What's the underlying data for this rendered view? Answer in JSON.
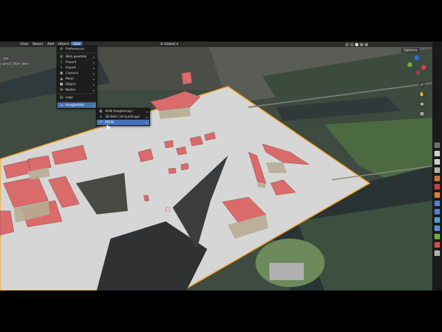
{
  "menubar": {
    "items": [
      "View",
      "Select",
      "Add",
      "Object",
      "Geo"
    ],
    "active_index": 4
  },
  "header": {
    "transform_orientation": "Global",
    "options_label": "Options"
  },
  "scene_overlay": {
    "view_name": "...ive",
    "object_name": "| ahn3_05m_dtm"
  },
  "geo_menu": {
    "items": [
      {
        "icon": "gear-icon",
        "label": "Preferences"
      },
      {
        "icon": "globe-icon",
        "label": "Web geodata",
        "submenu": true
      },
      {
        "icon": "import-icon",
        "label": "Import",
        "submenu": true
      },
      {
        "icon": "export-icon",
        "label": "Export",
        "submenu": true
      },
      {
        "icon": "camera-icon",
        "label": "Camera",
        "submenu": true
      },
      {
        "icon": "mesh-icon",
        "label": "Mesh",
        "submenu": true
      },
      {
        "icon": "cube-icon",
        "label": "Object",
        "submenu": true
      },
      {
        "icon": "nodes-icon",
        "label": "Nodes",
        "submenu": true
      },
      {
        "icon": "logs-icon",
        "label": "Logs"
      },
      {
        "icon": "hoogtedata-icon",
        "label": "Hoogtedata",
        "submenu": true,
        "highlighted": true
      }
    ]
  },
  "hoogtedata_submenu": {
    "items": [
      {
        "icon": "heightmap-icon",
        "label": "AHN (heightmap)",
        "submenu": true
      },
      {
        "icon": "buildings-icon",
        "label": "3D BAG (3d buildings)",
        "submenu": true
      },
      {
        "icon": "pdok-icon",
        "label": "PDOK",
        "submenu": true,
        "highlighted": true
      }
    ]
  },
  "colors": {
    "menu_bg": "#1d1d1d",
    "highlight": "#4772b3",
    "selection_outline": "#f5a020",
    "terrain": "#d6d6d6",
    "roof": "#d96b6b"
  }
}
